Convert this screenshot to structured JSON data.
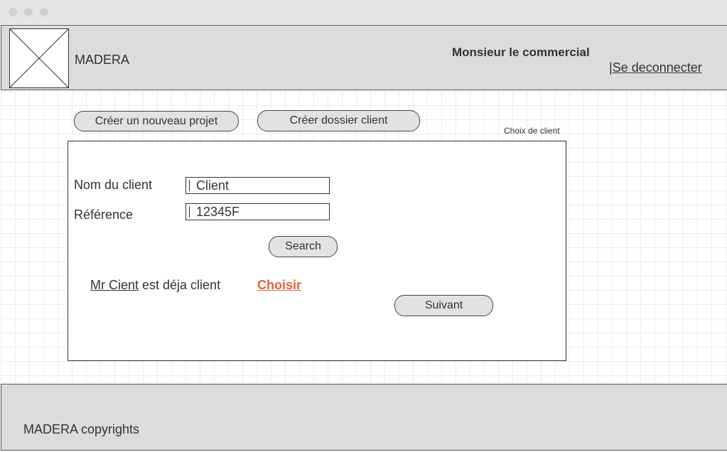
{
  "header": {
    "brand": "MADERA",
    "user_title": "Monsieur le commercial",
    "logout_separator": "|",
    "logout_label": "Se deconnecter"
  },
  "actions": {
    "new_project_label": "Créer un nouveau projet",
    "new_client_file_label": "Créer dossier client"
  },
  "panel": {
    "title": "Choix de client",
    "client_name_label": "Nom du client",
    "client_name_value": "Client",
    "reference_label": "Référence",
    "reference_value": "12345F",
    "search_label": "Search",
    "result_name": "Mr Cient",
    "result_suffix": " est déja client",
    "choose_label": "Choisir",
    "next_label": "Suivant"
  },
  "footer": {
    "copyright": "MADERA copyrights"
  },
  "colors": {
    "accent": "#e8603c",
    "header_bg": "#dcdcdc"
  }
}
